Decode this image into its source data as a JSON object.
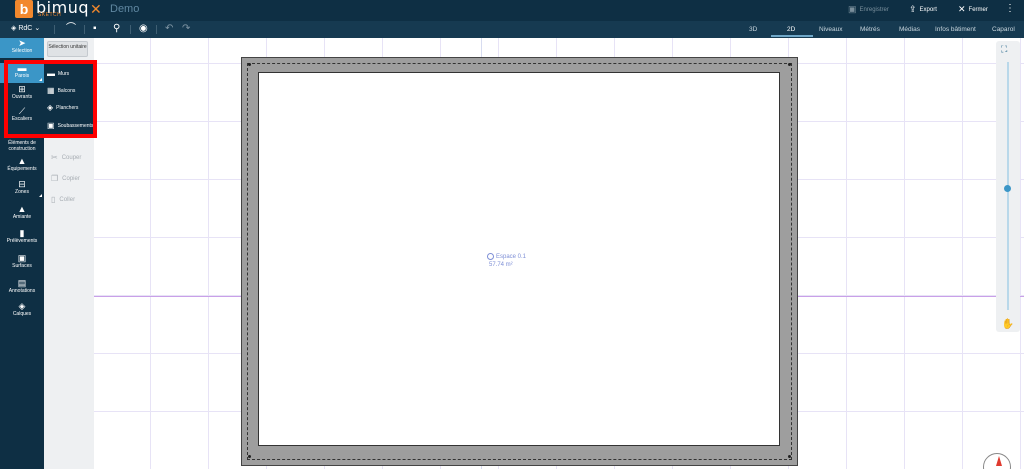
{
  "header": {
    "brand": "bimuq",
    "brand_sub": "SKETCH",
    "project_name": "Demo",
    "save_label": "Enregistrer",
    "export_label": "Export",
    "close_label": "Fermer"
  },
  "toolbar": {
    "level": "RdC",
    "tabs": [
      "3D",
      "2D",
      "Niveaux",
      "Métrés",
      "Médias",
      "Infos bâtiment",
      "Caparol"
    ],
    "active_tab": "2D"
  },
  "sidebar": {
    "items": [
      {
        "label": "Sélection",
        "icon": "cursor-icon"
      },
      {
        "label": "Parois",
        "icon": "wall-icon"
      },
      {
        "label": "Ouvrants",
        "icon": "window-icon"
      },
      {
        "label": "Escaliers",
        "icon": "stairs-icon"
      },
      {
        "label": "Éléments de construction",
        "icon": "construction-icon"
      },
      {
        "label": "Équipements",
        "icon": "equipment-icon"
      },
      {
        "label": "Zones",
        "icon": "zones-icon"
      },
      {
        "label": "Amiante",
        "icon": "warning-icon"
      },
      {
        "label": "Prélèvements",
        "icon": "sample-icon"
      },
      {
        "label": "Surfaces",
        "icon": "surface-icon"
      },
      {
        "label": "Annotations",
        "icon": "annotation-icon"
      },
      {
        "label": "Calques",
        "icon": "layers-icon"
      }
    ]
  },
  "subpanel": {
    "selection_label": "Sélection unitaire",
    "flyout": [
      {
        "label": "Murs",
        "icon": "wall-icon"
      },
      {
        "label": "Balcons",
        "icon": "balcony-icon"
      },
      {
        "label": "Planchers",
        "icon": "floor-icon"
      },
      {
        "label": "Soubassements",
        "icon": "foundation-icon"
      }
    ],
    "edit_actions": [
      {
        "label": "Couper",
        "icon": "scissors-icon"
      },
      {
        "label": "Copier",
        "icon": "copy-icon"
      },
      {
        "label": "Coller",
        "icon": "paste-icon"
      }
    ]
  },
  "canvas": {
    "space_name": "Espace 0.1",
    "space_area": "57.74 m²"
  },
  "colors": {
    "header_bg": "#0e2f44",
    "toolbar_bg": "#163a51",
    "accent": "#3b96c7",
    "brand_orange": "#f2882d",
    "highlight": "#ff0000"
  }
}
